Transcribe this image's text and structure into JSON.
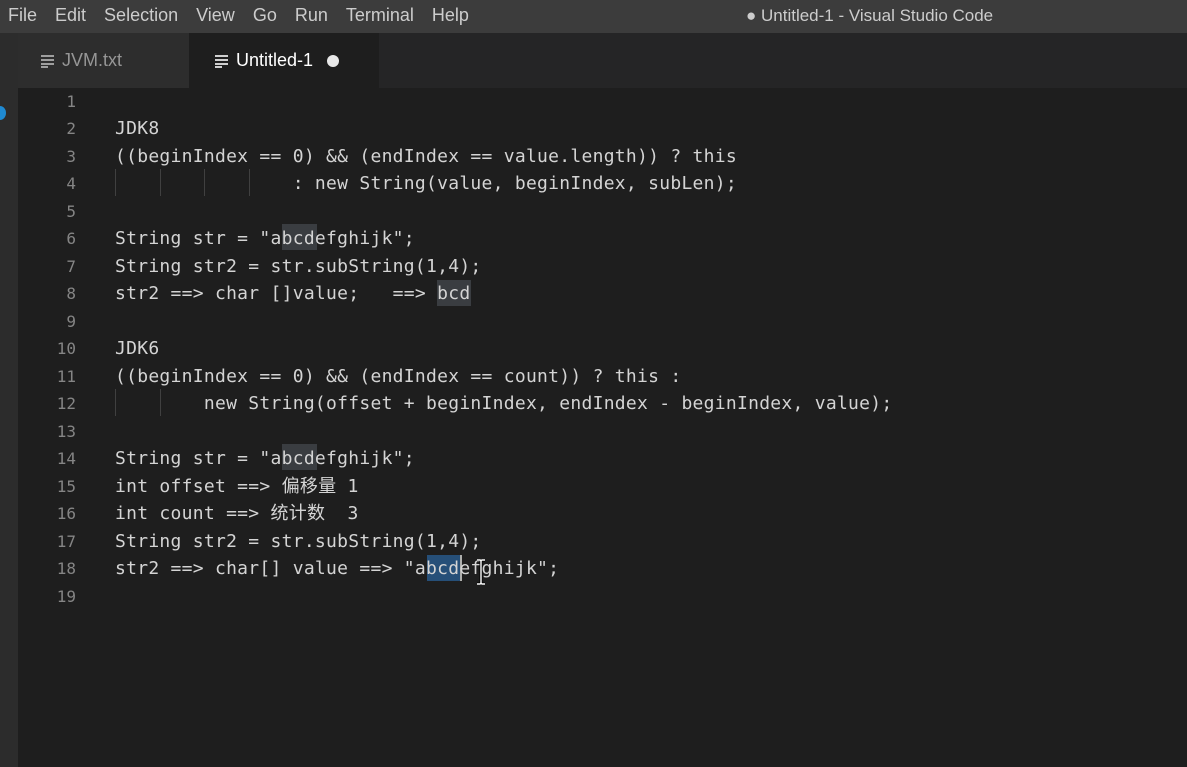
{
  "menu": [
    "File",
    "Edit",
    "Selection",
    "View",
    "Go",
    "Run",
    "Terminal",
    "Help"
  ],
  "window_title": "● Untitled-1 - Visual Studio Code",
  "tabs": [
    {
      "label": "JVM.txt",
      "icon": "text-file-icon",
      "active": false
    },
    {
      "label": "Untitled-1",
      "icon": "text-file-icon",
      "active": true,
      "dirty": true
    }
  ],
  "editor": {
    "lines": [
      {
        "num": "1",
        "text": ""
      },
      {
        "num": "2",
        "text": "JDK8"
      },
      {
        "num": "3",
        "text": "((beginIndex == 0) && (endIndex == value.length)) ? this"
      },
      {
        "num": "4",
        "text": "                : new String(value, beginIndex, subLen);"
      },
      {
        "num": "5",
        "text": ""
      },
      {
        "num": "6",
        "text": "String str = \"abcdefghijk\";"
      },
      {
        "num": "7",
        "text": "String str2 = str.subString(1,4);"
      },
      {
        "num": "8",
        "text": "str2 ==> char []value;   ==> bcd"
      },
      {
        "num": "9",
        "text": ""
      },
      {
        "num": "10",
        "text": "JDK6"
      },
      {
        "num": "11",
        "text": "((beginIndex == 0) && (endIndex == count)) ? this :"
      },
      {
        "num": "12",
        "text": "        new String(offset + beginIndex, endIndex - beginIndex, value);"
      },
      {
        "num": "13",
        "text": ""
      },
      {
        "num": "14",
        "text": "String str = \"abcdefghijk\";"
      },
      {
        "num": "15",
        "text": "int offset ==> 偏移量 1"
      },
      {
        "num": "16",
        "text": "int count ==> 统计数  3"
      },
      {
        "num": "17",
        "text": "String str2 = str.subString(1,4);"
      },
      {
        "num": "18",
        "text": "str2 ==> char[] value ==> \"abcdefghijk\";"
      },
      {
        "num": "19",
        "text": ""
      }
    ]
  },
  "colors": {
    "menubar": "#3c3c3c",
    "editor_bg": "#1e1e1e",
    "selection": "#264f78",
    "word_highlight": "#3a3d41",
    "line_number": "#858585",
    "text": "#d4d4d4"
  }
}
